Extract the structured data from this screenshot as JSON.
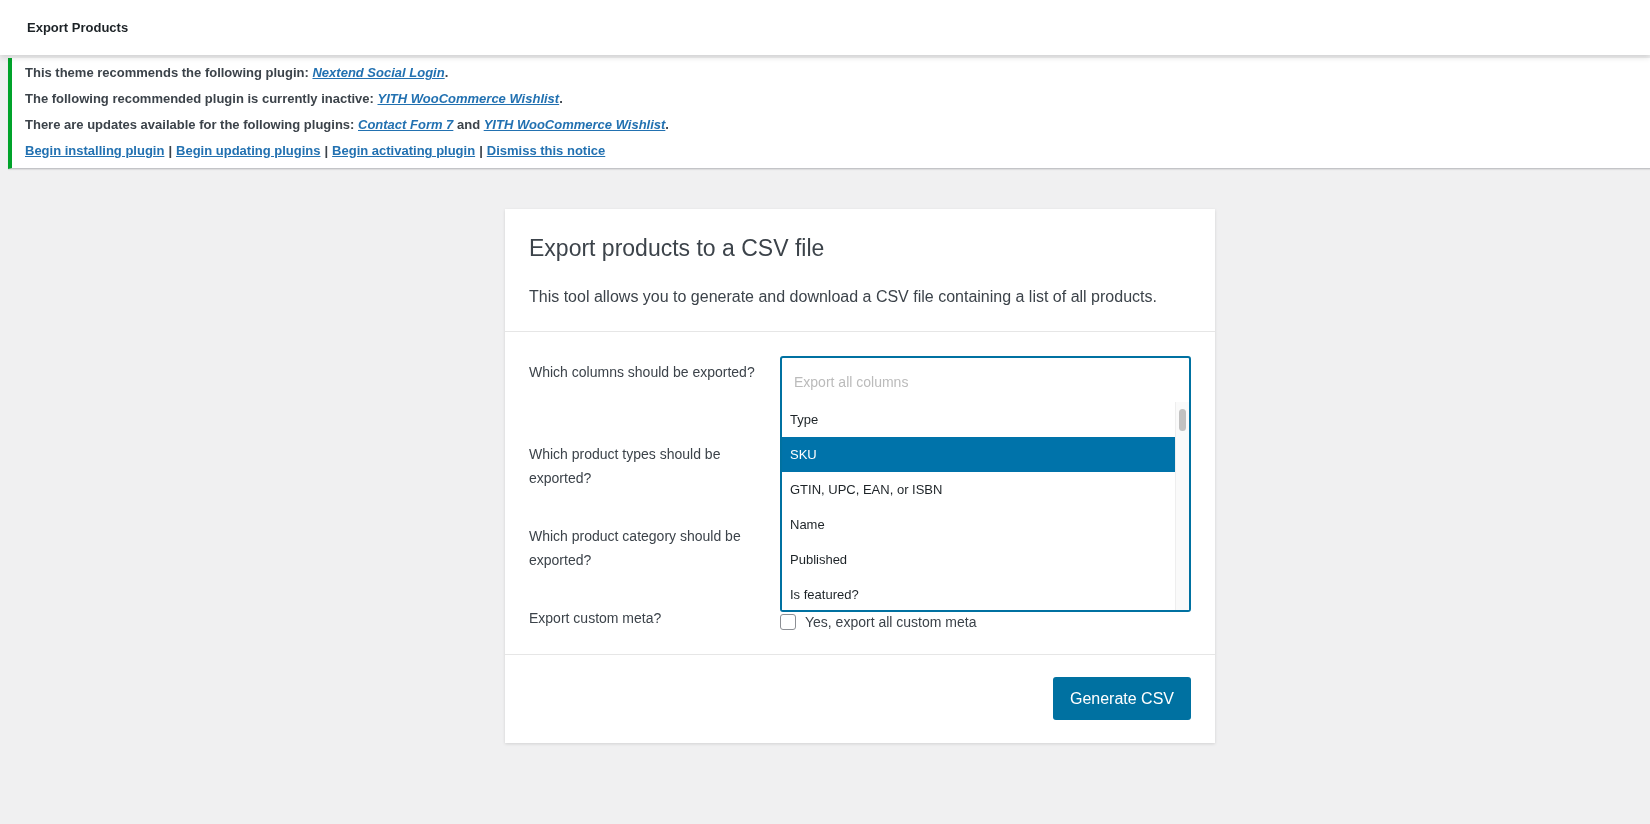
{
  "header": {
    "title": "Export Products"
  },
  "notice": {
    "lines": [
      [
        {
          "kind": "text",
          "text": "This theme recommends the following plugin: "
        },
        {
          "kind": "link",
          "text": "Nextend Social Login"
        },
        {
          "kind": "text",
          "text": "."
        }
      ],
      [
        {
          "kind": "text",
          "text": "The following recommended plugin is currently inactive: "
        },
        {
          "kind": "link",
          "text": "YITH WooCommerce Wishlist"
        },
        {
          "kind": "text",
          "text": "."
        }
      ],
      [
        {
          "kind": "text",
          "text": "There are updates available for the following plugins: "
        },
        {
          "kind": "link",
          "text": "Contact Form 7"
        },
        {
          "kind": "text",
          "text": " and "
        },
        {
          "kind": "link",
          "text": "YITH WooCommerce Wishlist"
        },
        {
          "kind": "text",
          "text": "."
        }
      ]
    ],
    "actions": [
      {
        "kind": "action",
        "text": "Begin installing plugin"
      },
      {
        "kind": "separator",
        "text": "|"
      },
      {
        "kind": "action",
        "text": "Begin updating plugins"
      },
      {
        "kind": "separator",
        "text": "|"
      },
      {
        "kind": "action",
        "text": "Begin activating plugin"
      },
      {
        "kind": "separator",
        "text": "|"
      },
      {
        "kind": "action",
        "text": "Dismiss this notice"
      }
    ]
  },
  "card": {
    "title": "Export products to a CSV file",
    "description": "This tool allows you to generate and download a CSV file containing a list of all products.",
    "fields": [
      {
        "kind": "multiselect",
        "label": "Which columns should be exported?",
        "placeholder": "Export all columns",
        "options": [
          {
            "label": "Type",
            "selected": false
          },
          {
            "label": "SKU",
            "selected": true
          },
          {
            "label": "GTIN, UPC, EAN, or ISBN",
            "selected": false
          },
          {
            "label": "Name",
            "selected": false
          },
          {
            "label": "Published",
            "selected": false
          },
          {
            "label": "Is featured?",
            "selected": false
          }
        ]
      },
      {
        "kind": "covered",
        "label": "Which product types should be exported?"
      },
      {
        "kind": "covered",
        "label": "Which product category should be exported?"
      },
      {
        "kind": "checkbox",
        "label": "Export custom meta?",
        "text": "Yes, export all custom meta",
        "checked": false
      }
    ],
    "button": "Generate CSV"
  }
}
